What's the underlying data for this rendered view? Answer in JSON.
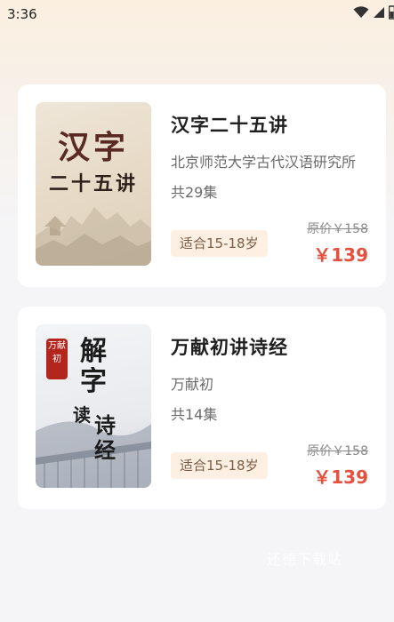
{
  "status_bar": {
    "time": "3:36",
    "icons": [
      "wifi-icon",
      "signal-icon",
      "battery-icon"
    ]
  },
  "courses": [
    {
      "cover_title_line1": "汉字",
      "cover_title_line2": "二十五讲",
      "title": "汉字二十五讲",
      "subtitle": "北京师范大学古代汉语研究所",
      "episodes": "共29集",
      "age": "适合15-18岁",
      "original_price": "原价￥158",
      "price": "￥139"
    },
    {
      "cover_seal": "万献初",
      "cover_vertical_1": "解字",
      "cover_vertical_2": "读",
      "cover_vertical_3": "诗经",
      "title": "万献初讲诗经",
      "subtitle": "万献初",
      "episodes": "共14集",
      "age": "适合15-18岁",
      "original_price": "原价￥158",
      "price": "￥139"
    }
  ],
  "watermark": "还德下载站",
  "colors": {
    "price_red": "#e5503f",
    "tag_bg": "#fdf0e3",
    "seal_red": "#b3261e"
  }
}
